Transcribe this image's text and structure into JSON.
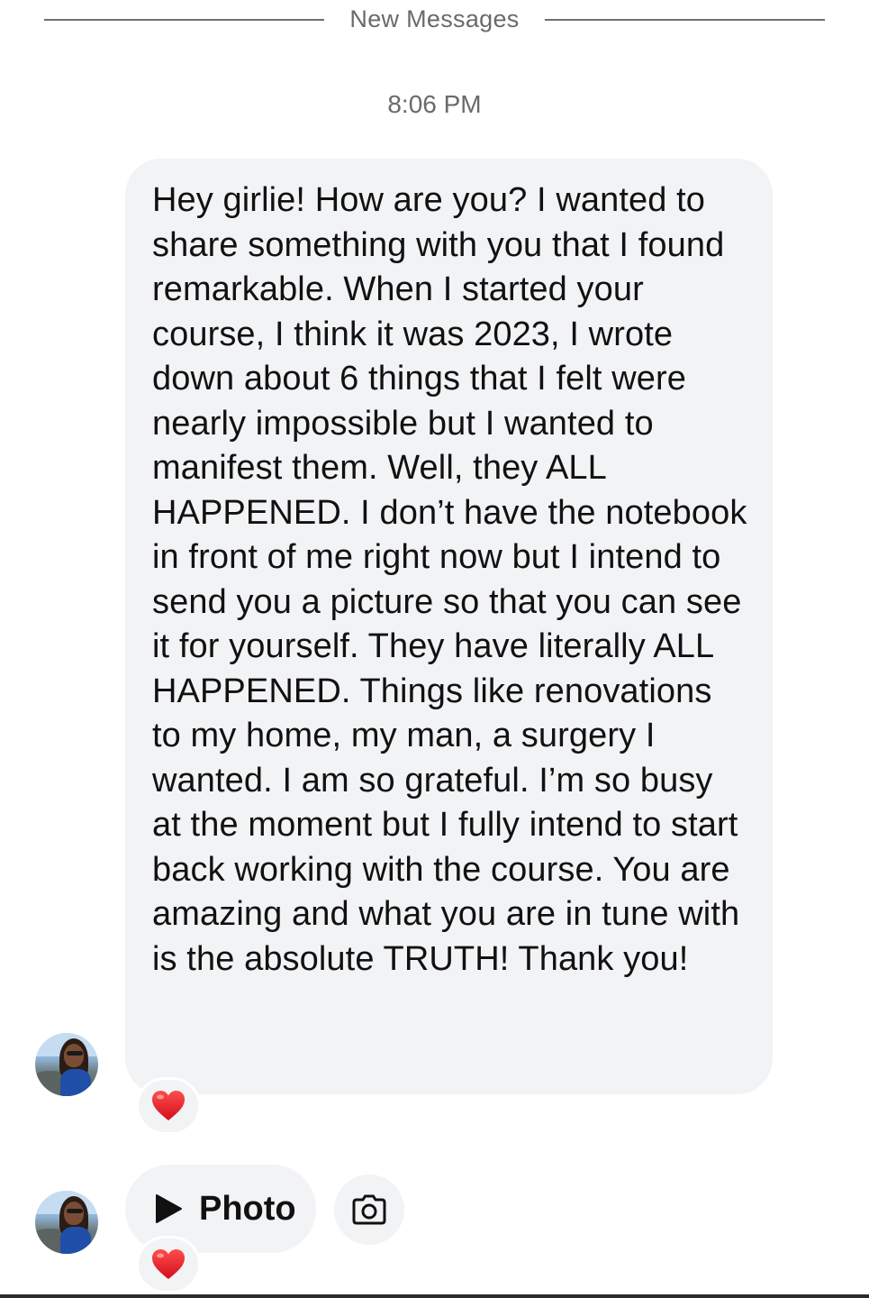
{
  "divider": {
    "label": "New Messages"
  },
  "timestamp": "8:06 PM",
  "message": {
    "text": "Hey girlie! How are you? I wanted to share something with you that I found remarkable. When I started your course, I think it was 2023, I wrote down about 6 things that I felt were nearly impossible but I wanted to manifest them. Well, they ALL HAPPENED. I don’t have the notebook in front of me right now but I intend to send you a picture so that you can see it for yourself. They have literally ALL HAPPENED. Things like renovations to my home, my man, a surgery I wanted. I am so grateful. I’m so busy at the moment but I fully intend to start back working with the course. You are amazing and what you are in tune with is the absolute TRUTH! Thank you!",
    "reaction": "heart-icon"
  },
  "attachment": {
    "label": "Photo",
    "icon": "play-icon",
    "reaction": "heart-icon",
    "action_icon": "camera-icon"
  },
  "colors": {
    "bubble": "#f2f3f5",
    "heart": "#e0141e",
    "muted_text": "#6a6a6a"
  }
}
